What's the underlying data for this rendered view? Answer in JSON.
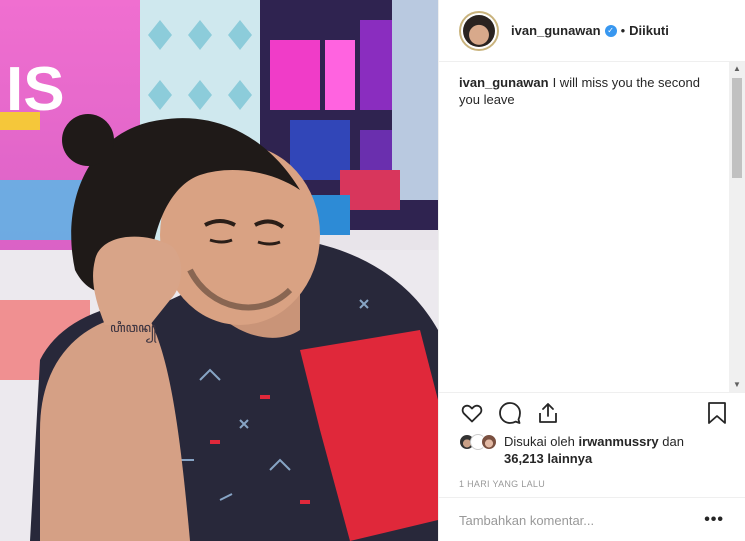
{
  "header": {
    "username": "ivan_gunawan",
    "separator": "•",
    "follow_status": "Diikuti"
  },
  "caption": {
    "username": "ivan_gunawan",
    "text": "I will miss you the second you leave"
  },
  "photo": {
    "background_sign_text": "IS",
    "tattoo_text": "ꦲꦶꦮꦤ꧀"
  },
  "likes": {
    "prefix": "Disukai oleh",
    "liker": "irwanmussry",
    "connector": "dan",
    "count_text": "36,213 lainnya"
  },
  "timestamp": "1 HARI YANG LALU",
  "comment": {
    "placeholder": "Tambahkan komentar...",
    "more_label": "•••"
  },
  "icons": {
    "like": "heart-icon",
    "comment": "comment-icon",
    "share": "share-icon",
    "save": "bookmark-icon",
    "verified": "verified-badge-icon"
  },
  "colors": {
    "verified": "#3897f0",
    "text": "#262626",
    "muted": "#999999",
    "border": "#efefef"
  }
}
